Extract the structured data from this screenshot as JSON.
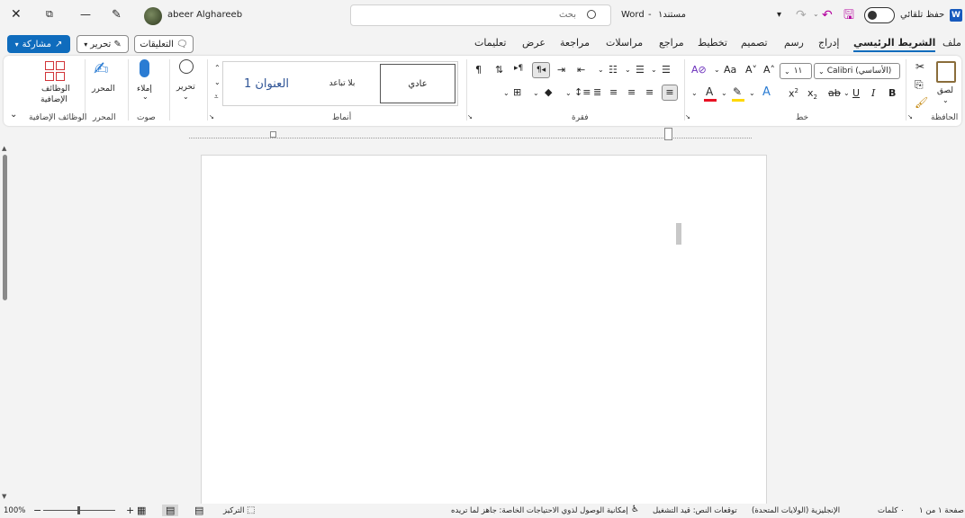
{
  "titlebar": {
    "app": "Word",
    "separator": "-",
    "doc_name": "مستند١",
    "search_placeholder": "بحث",
    "autosave_label": "حفظ تلقائي",
    "user_name": "abeer Alghareeb"
  },
  "tabs": {
    "file": "ملف",
    "home": "الشريط الرئيسي",
    "insert": "إدراج",
    "draw": "رسم",
    "design": "تصميم",
    "layout": "تخطيط",
    "references": "مراجع",
    "mailings": "مراسلات",
    "review": "مراجعة",
    "view": "عرض",
    "help": "تعليمات"
  },
  "actions": {
    "comments": "التعليقات",
    "editing": "تحرير",
    "share": "مشاركة"
  },
  "ribbon": {
    "clipboard": {
      "label": "الحافظة",
      "paste": "لصق"
    },
    "font": {
      "label": "خط",
      "font_name": "Calibri (الأساسي)",
      "font_size": "١١"
    },
    "paragraph": {
      "label": "فقرة"
    },
    "styles": {
      "label": "أنماط",
      "normal": "عادي",
      "no_spacing": "بلا تباعد",
      "heading1": "العنوان 1"
    },
    "editing": {
      "label": "تحرير"
    },
    "voice": {
      "label": "صوت",
      "dictate": "إملاء"
    },
    "editor": {
      "label": "المحرر",
      "editor_btn": "المحرر"
    },
    "addins": {
      "label": "الوظائف الإضافية",
      "addins_btn_line1": "الوظائف",
      "addins_btn_line2": "الإضافية"
    }
  },
  "colors": {
    "accent": "#0f6cbd",
    "font_color": "#e81123",
    "highlight": "#ffd800",
    "save_icon": "#b4009e"
  },
  "statusbar": {
    "page": "صفحة ١ من ١",
    "words": "٠ كلمات",
    "language": "الإنجليزية (الولايات المتحدة)",
    "text_predictions": "توقعات النص: قيد التشغيل",
    "accessibility": "إمكانية الوصول لذوي الاحتياجات الخاصة: جاهز لما تريده",
    "focus": "التركيز",
    "zoom": "100%"
  }
}
